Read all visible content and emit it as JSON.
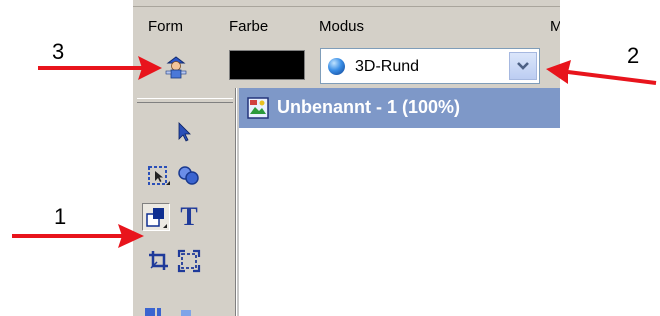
{
  "properties_bar": {
    "form_label": "Form",
    "color_label": "Farbe",
    "mode_label": "Modus",
    "extra_label_cut": "M",
    "shape_icon": "character-figure-icon",
    "color_value": "#000000",
    "mode_select": {
      "selected": "3D-Rund",
      "icon": "sphere-icon"
    }
  },
  "document": {
    "title": "Unbenannt - 1 (100%)"
  },
  "toolbox": {
    "tools": [
      {
        "name": "pointer-tool",
        "icon": "arrow-cursor-icon",
        "active": false
      },
      {
        "name": "selection-tool",
        "icon": "marquee-select-icon",
        "active": false
      },
      {
        "name": "shape-combine-tool",
        "icon": "circles-icon",
        "active": false
      },
      {
        "name": "shape-tool",
        "icon": "shapes-icon",
        "active": true
      },
      {
        "name": "text-tool",
        "icon": "text-t-icon",
        "active": false
      },
      {
        "name": "crop-tool",
        "icon": "crop-icon",
        "active": false
      },
      {
        "name": "resize-tool",
        "icon": "resize-frame-icon",
        "active": false
      }
    ],
    "text_tool_glyph": "T"
  },
  "annotations": {
    "arrow_color": "#e8141c",
    "callouts": [
      {
        "number": "1",
        "points_to": "shape-tool"
      },
      {
        "number": "2",
        "points_to": "mode-dropdown-button"
      },
      {
        "number": "3",
        "points_to": "form-shape-icon"
      }
    ]
  }
}
